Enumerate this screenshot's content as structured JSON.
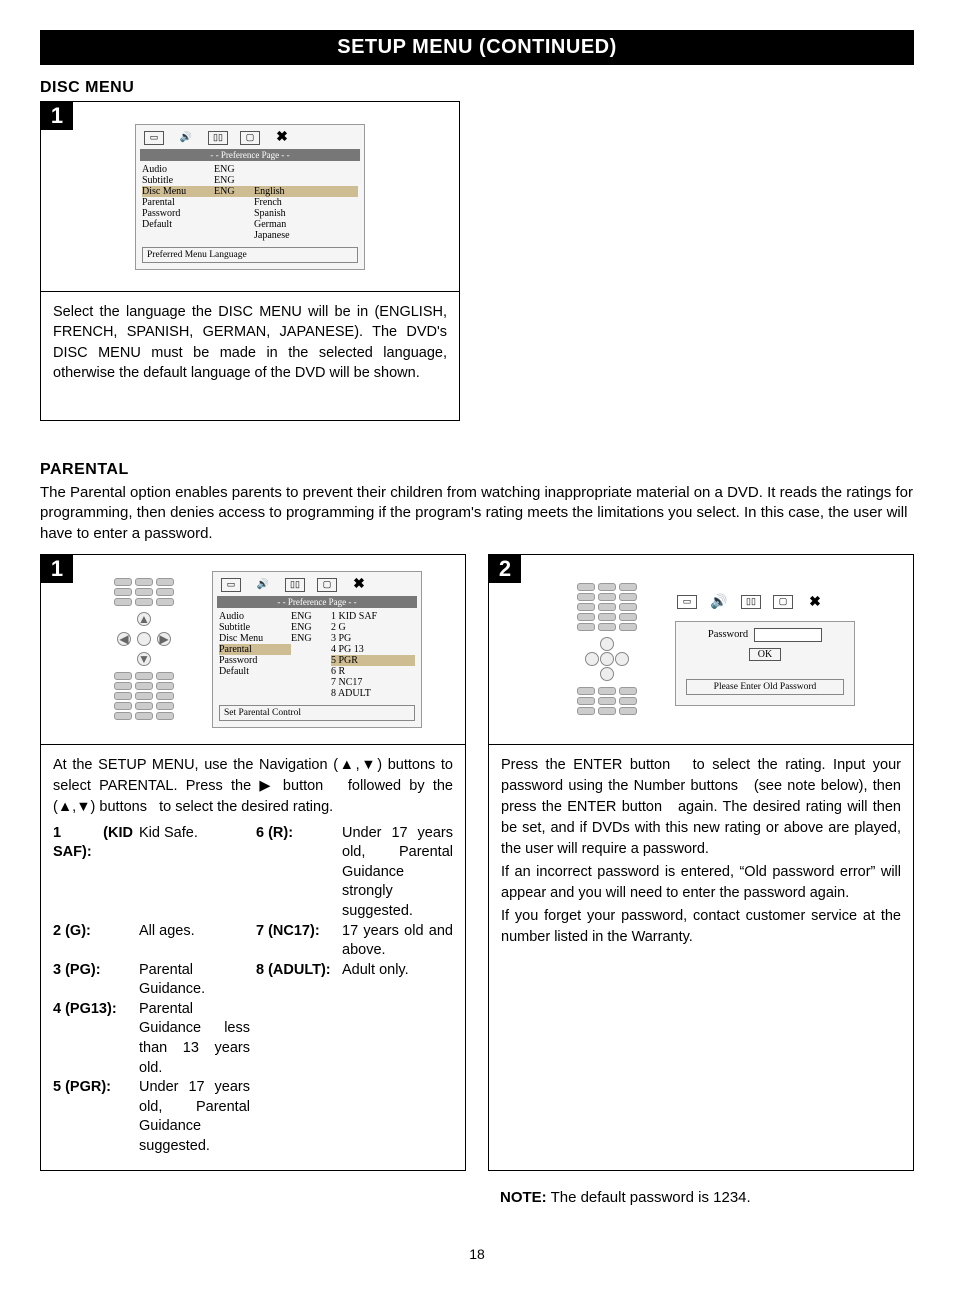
{
  "header": {
    "title": "SETUP MENU (CONTINUED)"
  },
  "disc_menu": {
    "section_title": "DISC MENU",
    "step": "1",
    "osd": {
      "title": "- - Preference Page - -",
      "items": [
        {
          "label": "Audio",
          "val": "ENG",
          "opt": ""
        },
        {
          "label": "Subtitle",
          "val": "ENG",
          "opt": ""
        },
        {
          "label": "Disc Menu",
          "val": "ENG",
          "opt": "English",
          "hl": true
        },
        {
          "label": "Parental",
          "val": "",
          "opt": "French"
        },
        {
          "label": "Password",
          "val": "",
          "opt": "Spanish"
        },
        {
          "label": "Default",
          "val": "",
          "opt": "German"
        },
        {
          "label": "",
          "val": "",
          "opt": "Japanese"
        }
      ],
      "footer": "Preferred Menu Language"
    },
    "instruction": "Select the language the DISC MENU will be in (ENGLISH, FRENCH, SPANISH, GERMAN, JAPANESE). The DVD's DISC MENU must be made in the selected language, otherwise the default language of the DVD will be shown."
  },
  "parental": {
    "section_title": "PARENTAL",
    "intro": "The Parental option enables parents to prevent their children from watching inappropriate material on a DVD. It reads the ratings for programming, then denies access to programming if the program's rating meets the limitations you select. In this case, the user will have to enter a password.",
    "step1": {
      "badge": "1",
      "osd": {
        "title": "- - Preference Page - -",
        "items": [
          {
            "label": "Audio",
            "val": "ENG",
            "opt": "1  KID SAF"
          },
          {
            "label": "Subtitle",
            "val": "ENG",
            "opt": "2  G"
          },
          {
            "label": "Disc Menu",
            "val": "ENG",
            "opt": "3  PG"
          },
          {
            "label": "Parental",
            "val": "",
            "opt": "4  PG 13",
            "hl_label": true
          },
          {
            "label": "Password",
            "val": "",
            "opt": "5  PGR",
            "hl_opt": true
          },
          {
            "label": "Default",
            "val": "",
            "opt": "6  R"
          },
          {
            "label": "",
            "val": "",
            "opt": "7  NC17"
          },
          {
            "label": "",
            "val": "",
            "opt": "8  ADULT"
          }
        ],
        "footer": "Set Parental Control"
      },
      "instr_lead": "At the SETUP MENU, use the Navigation (▲,▼) buttons to select PARENTAL. Press the ▶ button   followed by the (▲,▼) buttons   to select the desired rating.",
      "ratings": [
        {
          "label": "1 (KID SAF):",
          "desc": "Kid Safe."
        },
        {
          "label": "2 (G):",
          "desc": "All ages."
        },
        {
          "label": "3 (PG):",
          "desc": "Parental Guidance."
        },
        {
          "label": "4 (PG13):",
          "desc": "Parental Guidance less than 13 years old."
        },
        {
          "label": "5 (PGR):",
          "desc": "Under 17 years old, Parental Guidance suggested."
        },
        {
          "label": "6 (R):",
          "desc": "Under 17 years old, Parental Guidance strongly suggested."
        },
        {
          "label": "7 (NC17):",
          "desc": "17 years old and above."
        },
        {
          "label": "8 (ADULT):",
          "desc": "Adult only."
        }
      ]
    },
    "step2": {
      "badge": "2",
      "pw_osd": {
        "label": "Password",
        "ok": "OK",
        "prompt": "Please Enter Old Password"
      },
      "instr": "Press the ENTER button   to select the rating. Input your password using the Number buttons   (see note below), then press the ENTER button   again. The desired rating will then be set, and if DVDs with this new rating or above are played, the user will require a password.\nIf an incorrect password is entered, “Old password error” will appear and you will need to enter the password again.\nIf you forget your password, contact customer service at the number listed in the Warranty."
    },
    "note_label": "NOTE:",
    "note_text": " The default password is 1234."
  },
  "page_number": "18"
}
